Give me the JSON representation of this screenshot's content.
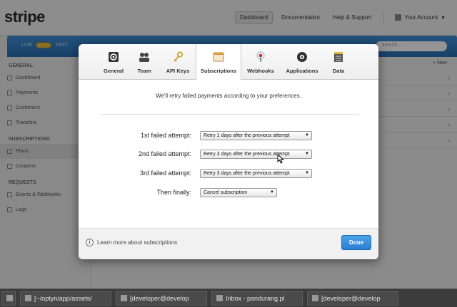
{
  "app": {
    "logo": "stripe",
    "top_nav": [
      "Dashboard",
      "Documentation",
      "Help & Support"
    ],
    "account_label": "Your Account",
    "mode_live": "LIVE",
    "mode_test": "TEST",
    "search_placeholder": "Search..."
  },
  "sidebar": {
    "sections": [
      {
        "title": "GENERAL",
        "items": [
          "Dashboard",
          "Payments",
          "Customers",
          "Transfers"
        ]
      },
      {
        "title": "SUBSCRIPTIONS",
        "items": [
          "Plans",
          "Coupons"
        ]
      },
      {
        "title": "REQUESTS",
        "items": [
          "Events & Webhooks",
          "Logs"
        ]
      }
    ],
    "active_item": "Plans"
  },
  "main": {
    "new_label": "+ New"
  },
  "modal": {
    "tabs": [
      {
        "label": "General",
        "icon": "gear-icon"
      },
      {
        "label": "Team",
        "icon": "team-icon"
      },
      {
        "label": "API Keys",
        "icon": "key-icon"
      },
      {
        "label": "Subscriptions",
        "icon": "subscriptions-icon"
      },
      {
        "label": "Webhooks",
        "icon": "webhook-icon"
      },
      {
        "label": "Applications",
        "icon": "applications-icon"
      },
      {
        "label": "Data",
        "icon": "data-icon"
      }
    ],
    "selected_tab": "Subscriptions",
    "intro": "We'll retry failed payments according to your preferences.",
    "rows": [
      {
        "label": "1st failed attempt:",
        "value": "Retry 1 days after the previous attempt"
      },
      {
        "label": "2nd failed attempt:",
        "value": "Retry 3 days after the previous attempt"
      },
      {
        "label": "3rd failed attempt:",
        "value": "Retry 3 days after the previous attempt"
      },
      {
        "label": "Then finally:",
        "value": "Cancel subscription"
      }
    ],
    "footer_link": "Learn more about subscriptions",
    "done_label": "Done"
  },
  "taskbar": {
    "items": [
      "[~/optyn/app/assets/",
      "[developer@develop",
      "Inbox - pandurang.pl",
      "[developer@develop"
    ]
  },
  "colors": {
    "accent_blue": "#2b7fd0",
    "stripe_bar": "#3f8fd6"
  }
}
